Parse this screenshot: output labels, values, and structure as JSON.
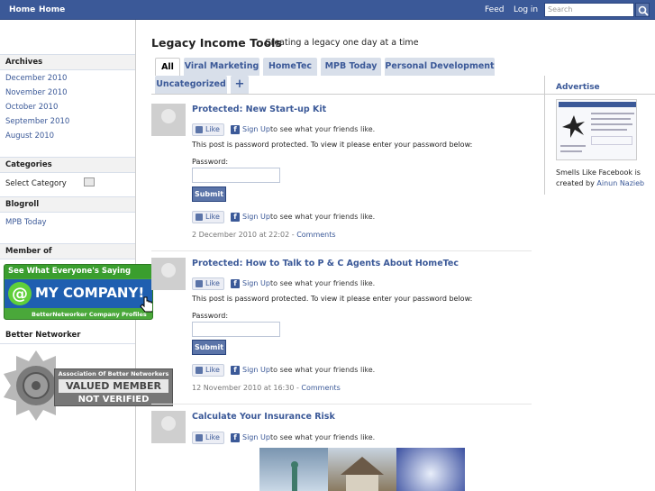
{
  "topbar": {
    "home1": "Home",
    "home2": "Home",
    "feed": "Feed",
    "login": "Log in",
    "search_placeholder": "Search"
  },
  "sidebar": {
    "archives_title": "Archives",
    "archives": [
      "December 2010",
      "November 2010",
      "October 2010",
      "September 2010",
      "August 2010"
    ],
    "categories_title": "Categories",
    "category_select": "Select Category",
    "blogroll_title": "Blogroll",
    "blogroll": [
      "MPB Today"
    ],
    "member_title": "Member of",
    "member_badge": {
      "top": "See What Everyone's Saying About",
      "main": "MY COMPANY!",
      "bottom": "BetterNetworker Company Profiles"
    },
    "better_title": "Better Networker",
    "network_badge": {
      "line1": "Association Of Better Networkers",
      "line2": "VALUED MEMBER",
      "line3": "NOT VERIFIED"
    }
  },
  "site": {
    "title": "Legacy Income Tools",
    "tagline": "Creating a legacy one day at a time"
  },
  "tabs": [
    "All",
    "Viral Marketing",
    "HomeTec",
    "MPB Today",
    "Personal Development",
    "Uncategorized",
    "+"
  ],
  "posts": [
    {
      "title": "Protected: New Start-up Kit",
      "like": "Like",
      "signup": "Sign Up",
      "signtext": "to see what your friends like.",
      "protected": "This post is password protected. To view it please enter your password below:",
      "password_label": "Password:",
      "submit": "Submit",
      "date": "2 December 2010 at 22:02",
      "comments": "Comments"
    },
    {
      "title": "Protected: How to Talk to P & C Agents About HomeTec",
      "like": "Like",
      "signup": "Sign Up",
      "signtext": "to see what your friends like.",
      "protected": "This post is password protected. To view it please enter your password below:",
      "password_label": "Password:",
      "submit": "Submit",
      "date": "12 November 2010 at 16:30",
      "comments": "Comments"
    },
    {
      "title": "Calculate Your Insurance Risk",
      "like": "Like",
      "signup": "Sign Up",
      "signtext": "to see what your friends like."
    }
  ],
  "advertise": {
    "title": "Advertise",
    "text_pre": "Smells Like Facebook is created by",
    "author": "Ainun Nazieb"
  },
  "colors": {
    "brand": "#3b5998",
    "tab_bg": "#d8dfea",
    "badge_green": "#3a9e2e"
  }
}
